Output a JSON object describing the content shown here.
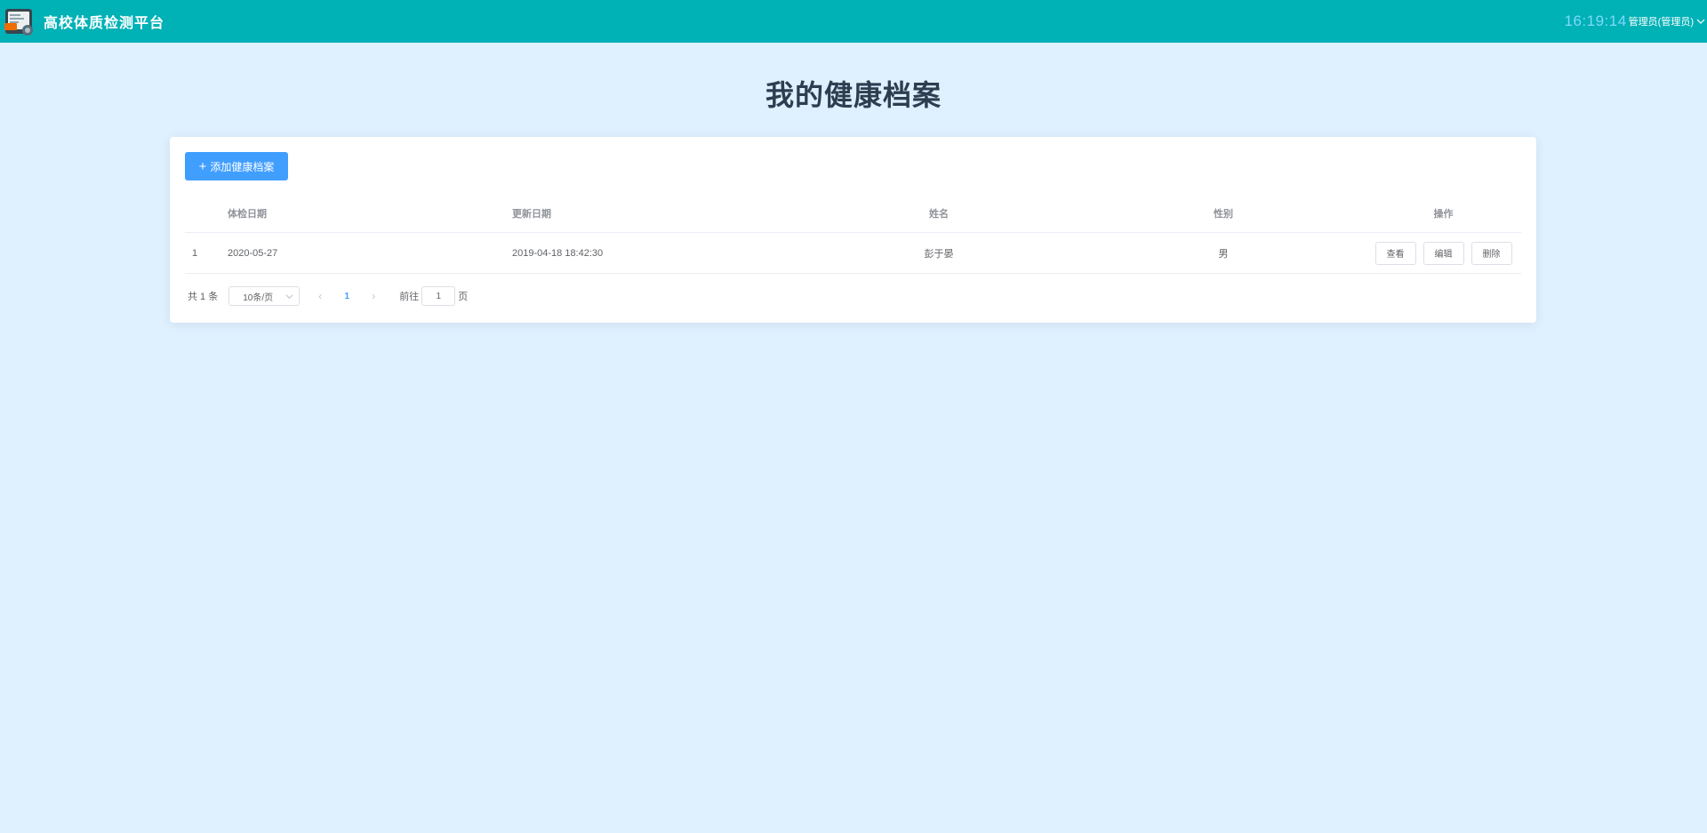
{
  "header": {
    "brand": "高校体质检测平台",
    "clock": "16:19:14",
    "user": "管理员(管理员)"
  },
  "page": {
    "title": "我的健康档案"
  },
  "toolbar": {
    "add_label": "添加健康档案"
  },
  "table": {
    "columns": [
      "",
      "体检日期",
      "更新日期",
      "姓名",
      "性别",
      "操作"
    ],
    "rows": [
      {
        "index": "1",
        "exam_date": "2020-05-27",
        "updated": "2019-04-18 18:42:30",
        "name": "彭于晏",
        "sex": "男"
      }
    ],
    "actions": {
      "view": "查看",
      "edit": "编辑",
      "delete": "删除"
    }
  },
  "pagination": {
    "total": "共 1 条",
    "page_size": "10条/页",
    "current_page": "1",
    "goto_prefix": "前往",
    "goto_value": "1",
    "goto_suffix": "页"
  },
  "colors": {
    "header_bg": "#00b1b6",
    "page_bg": "#dff0ff",
    "primary": "#409eff"
  }
}
